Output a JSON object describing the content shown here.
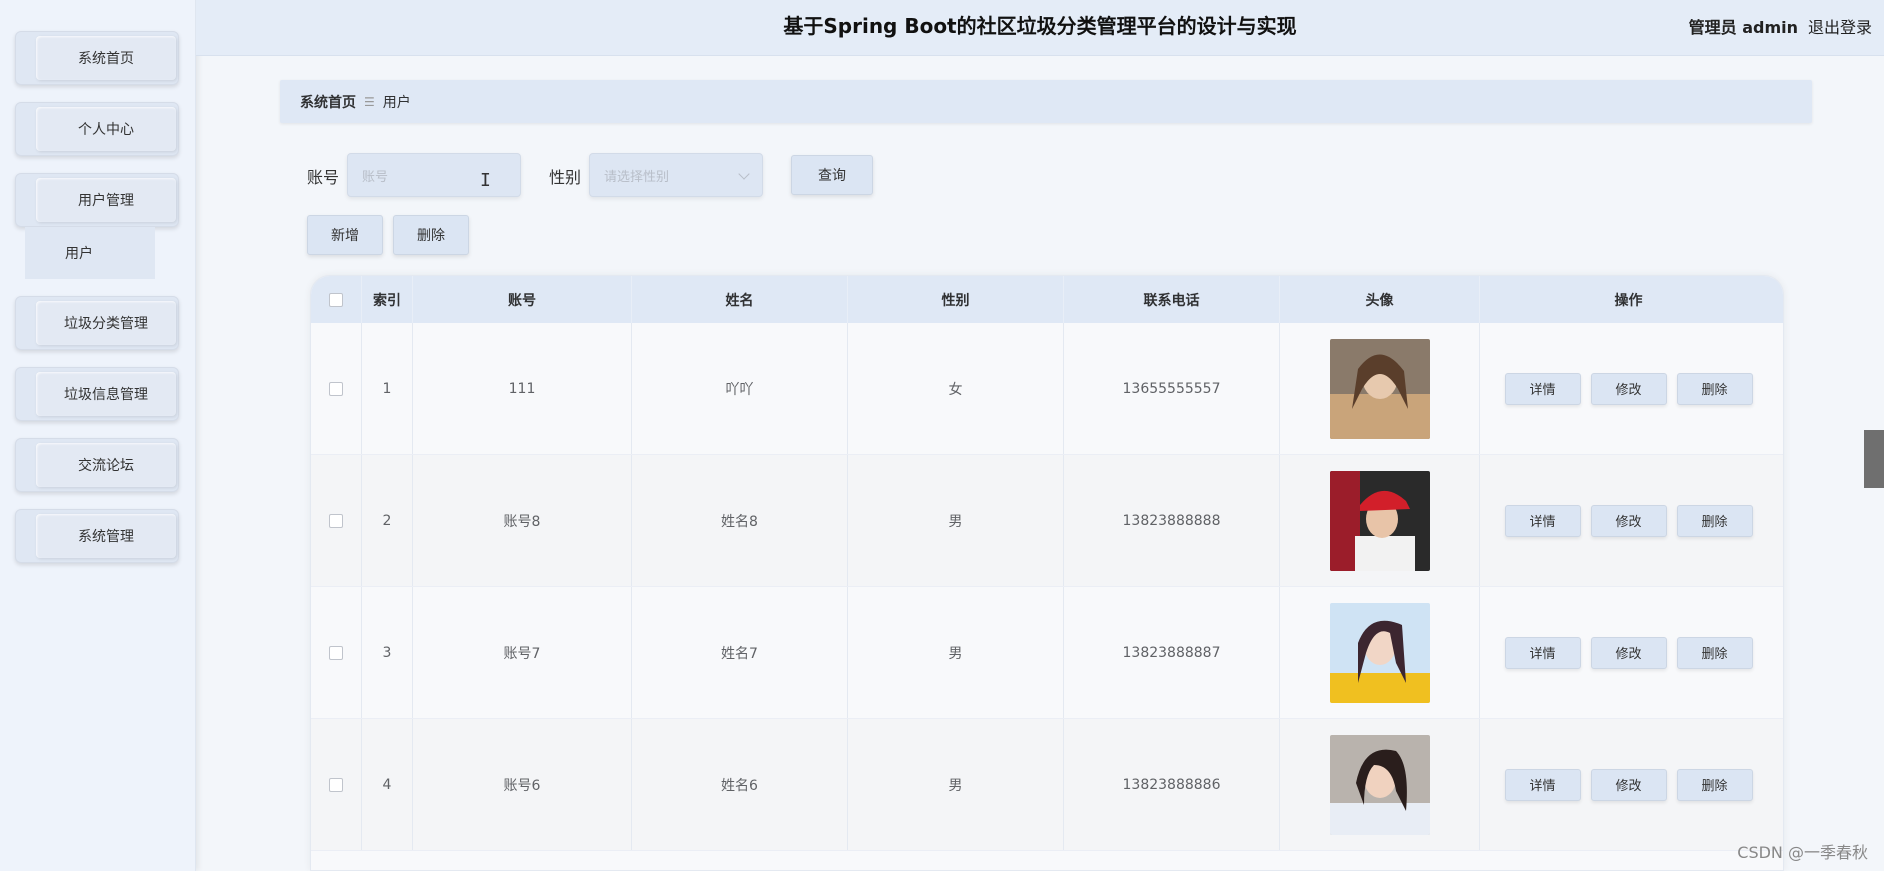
{
  "sidebar": {
    "items": [
      {
        "label": "系统首页"
      },
      {
        "label": "个人中心"
      },
      {
        "label": "用户管理"
      },
      {
        "label": "垃圾分类管理"
      },
      {
        "label": "垃圾信息管理"
      },
      {
        "label": "交流论坛"
      },
      {
        "label": "系统管理"
      }
    ],
    "submenu_label": "用户"
  },
  "header": {
    "title": "基于Spring Boot的社区垃圾分类管理平台的设计与实现",
    "user": "管理员 admin",
    "logout": "退出登录"
  },
  "breadcrumb": {
    "home": "系统首页",
    "separator_icon": "bars-icon",
    "current": "用户"
  },
  "search": {
    "account_label": "账号",
    "account_placeholder": "账号",
    "gender_label": "性别",
    "gender_placeholder": "请选择性别",
    "query_button": "查询"
  },
  "actions": {
    "add": "新增",
    "delete": "删除"
  },
  "table": {
    "headers": [
      "索引",
      "账号",
      "姓名",
      "性别",
      "联系电话",
      "头像",
      "操作"
    ],
    "rows": [
      {
        "index": "1",
        "account": "111",
        "name": "吖吖",
        "gender": "女",
        "phone": "13655555557",
        "avatar_icon": "avatar-photo-icon"
      },
      {
        "index": "2",
        "account": "账号8",
        "name": "姓名8",
        "gender": "男",
        "phone": "13823888888",
        "avatar_icon": "avatar-photo-icon"
      },
      {
        "index": "3",
        "account": "账号7",
        "name": "姓名7",
        "gender": "男",
        "phone": "13823888887",
        "avatar_icon": "avatar-photo-icon"
      },
      {
        "index": "4",
        "account": "账号6",
        "name": "姓名6",
        "gender": "男",
        "phone": "13823888886",
        "avatar_icon": "avatar-photo-icon"
      }
    ],
    "op_labels": {
      "detail": "详情",
      "edit": "修改",
      "delete": "删除"
    }
  },
  "watermark": "CSDN @一季春秋",
  "colors": {
    "sidebar_bg": "#eef3fb",
    "header_bg": "#e4ecf7",
    "button_bg": "#dbe5f3"
  }
}
